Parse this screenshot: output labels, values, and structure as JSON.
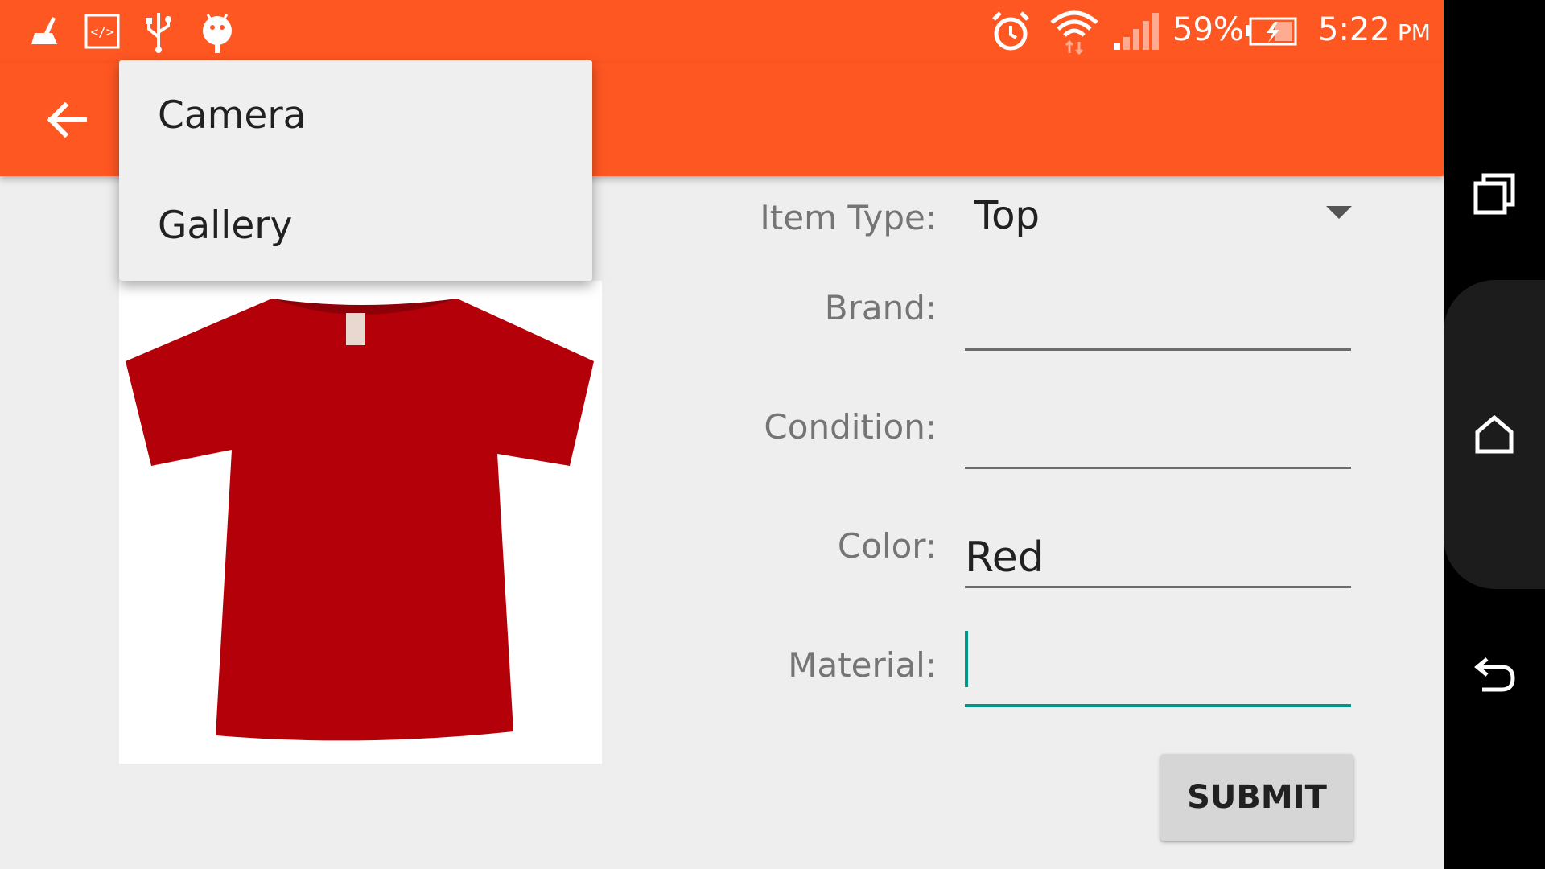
{
  "status_bar": {
    "left_icons": [
      "cleaner-icon",
      "code-icon",
      "usb-icon",
      "android-debug-icon"
    ],
    "right_icons": [
      "alarm-icon",
      "wifi-icon",
      "signal-icon",
      "battery-charging-icon"
    ],
    "battery_percent": "59%",
    "time": "5:22",
    "ampm": "PM"
  },
  "toolbar": {
    "back_icon": "arrow-back-icon",
    "color": "#ff5722"
  },
  "popup_menu": {
    "items": [
      {
        "label": "Camera"
      },
      {
        "label": "Gallery"
      }
    ]
  },
  "form": {
    "item_type": {
      "label": "Item Type:",
      "value": "Top"
    },
    "brand": {
      "label": "Brand:",
      "value": ""
    },
    "condition": {
      "label": "Condition:",
      "value": ""
    },
    "color": {
      "label": "Color:",
      "value": "Red"
    },
    "material": {
      "label": "Material:",
      "value": ""
    },
    "submit_label": "SUBMIT"
  },
  "image": {
    "subject": "red-tshirt"
  },
  "nav_bar": {
    "buttons": [
      "recent-apps-icon",
      "home-icon",
      "back-icon"
    ]
  },
  "colors": {
    "accent": "#ff5722",
    "focus": "#009688",
    "background": "#eeeeee"
  }
}
